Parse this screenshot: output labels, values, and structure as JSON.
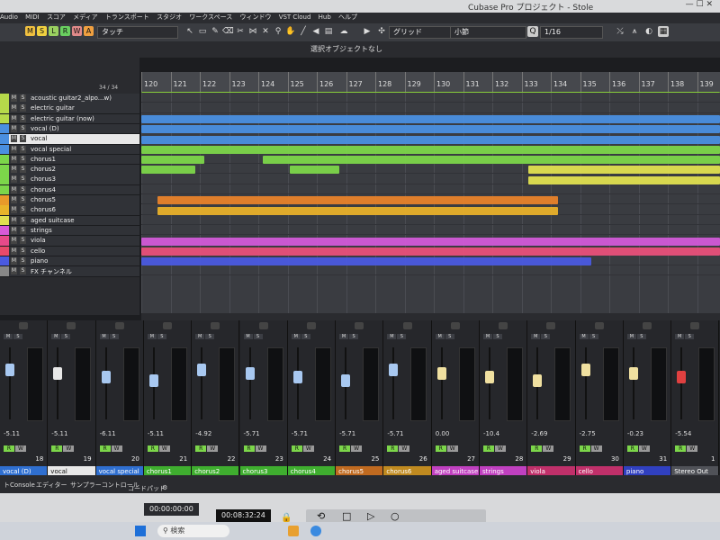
{
  "window": {
    "title": "Cubase Pro プロジェクト - Stole"
  },
  "menu": [
    "Audio",
    "MIDI",
    "スコア",
    "メディア",
    "トランスポート",
    "スタジオ",
    "ワークスペース",
    "ウィンドウ",
    "VST Cloud",
    "Hub",
    "ヘルプ"
  ],
  "toolbar": {
    "mode_buttons": [
      "M",
      "S",
      "L",
      "R",
      "W",
      "A"
    ],
    "automation_mode": "タッチ",
    "grid_label": "グリッド",
    "grid_type": "小節",
    "quantize": "1/16"
  },
  "info_line": "選択オブジェクトなし",
  "track_counter": "34 / 34",
  "ruler": [
    "120",
    "121",
    "122",
    "123",
    "124",
    "125",
    "126",
    "127",
    "128",
    "129",
    "130",
    "131",
    "132",
    "133",
    "134",
    "135",
    "136",
    "137",
    "138",
    "139"
  ],
  "tracks": [
    {
      "name": "acoustic guitar2_alpo...w)",
      "color": "#b6d94a"
    },
    {
      "name": "electric guitar",
      "color": "#b6d94a"
    },
    {
      "name": "electric guitar (now)",
      "color": "#b6d94a"
    },
    {
      "name": "vocal (D)",
      "color": "#4a8fe0"
    },
    {
      "name": "vocal",
      "color": "#4a8fe0"
    },
    {
      "name": "vocal special",
      "color": "#4a8fe0"
    },
    {
      "name": "chorus1",
      "color": "#7cd64a"
    },
    {
      "name": "chorus2",
      "color": "#7cd64a"
    },
    {
      "name": "chorus3",
      "color": "#7cd64a"
    },
    {
      "name": "chorus4",
      "color": "#7cd64a"
    },
    {
      "name": "chorus5",
      "color": "#e89a2a"
    },
    {
      "name": "chorus6",
      "color": "#e8b42a"
    },
    {
      "name": "aged suitcase",
      "color": "#e0e050"
    },
    {
      "name": "strings",
      "color": "#d85ad8"
    },
    {
      "name": "viola",
      "color": "#e84a8a"
    },
    {
      "name": "cello",
      "color": "#e84a6a"
    },
    {
      "name": "piano",
      "color": "#4a5ae0"
    },
    {
      "name": "FX チャンネル",
      "color": "#888888"
    }
  ],
  "mixer": {
    "strips": [
      {
        "name": "vocal (D)",
        "vol": "-5.11",
        "num": "18",
        "color": "#2f6fd0"
      },
      {
        "name": "vocal",
        "vol": "-5.11",
        "num": "19",
        "color": "#e8e8e8"
      },
      {
        "name": "vocal special",
        "vol": "-6.11",
        "num": "20",
        "color": "#2f6fd0"
      },
      {
        "name": "chorus1",
        "vol": "-5.11",
        "num": "21",
        "color": "#3fae2f"
      },
      {
        "name": "chorus2",
        "vol": "-4.92",
        "num": "22",
        "color": "#3fae2f"
      },
      {
        "name": "chorus3",
        "vol": "-5.71",
        "num": "23",
        "color": "#3fae2f"
      },
      {
        "name": "chorus4",
        "vol": "-5.71",
        "num": "24",
        "color": "#3fae2f"
      },
      {
        "name": "chorus5",
        "vol": "-5.71",
        "num": "25",
        "color": "#c06a20"
      },
      {
        "name": "chorus6",
        "vol": "-5.71",
        "num": "26",
        "color": "#c08a20"
      },
      {
        "name": "aged suitcase",
        "vol": "0.00",
        "num": "27",
        "color": "#c040c0"
      },
      {
        "name": "strings",
        "vol": "-10.4",
        "num": "28",
        "color": "#c040c0"
      },
      {
        "name": "viola",
        "vol": "-2.69",
        "num": "29",
        "color": "#c0306a"
      },
      {
        "name": "cello",
        "vol": "-2.75",
        "num": "30",
        "color": "#c0306a"
      },
      {
        "name": "piano",
        "vol": "-0.23",
        "num": "31",
        "color": "#3040c0"
      },
      {
        "name": "Stereo Out",
        "vol": "-5.54",
        "num": "1",
        "color": "#505258"
      }
    ],
    "rw_labels": [
      "R",
      "W"
    ],
    "ms_labels": [
      "M",
      "S"
    ]
  },
  "lower_tabs": [
    "トConsole",
    "エディター",
    "サンプラーコントロール",
    "コードパッド"
  ],
  "transport": {
    "time1": "00:00:00:00",
    "time2": "00:08:32:24"
  },
  "taskbar": {
    "search": "検索"
  }
}
